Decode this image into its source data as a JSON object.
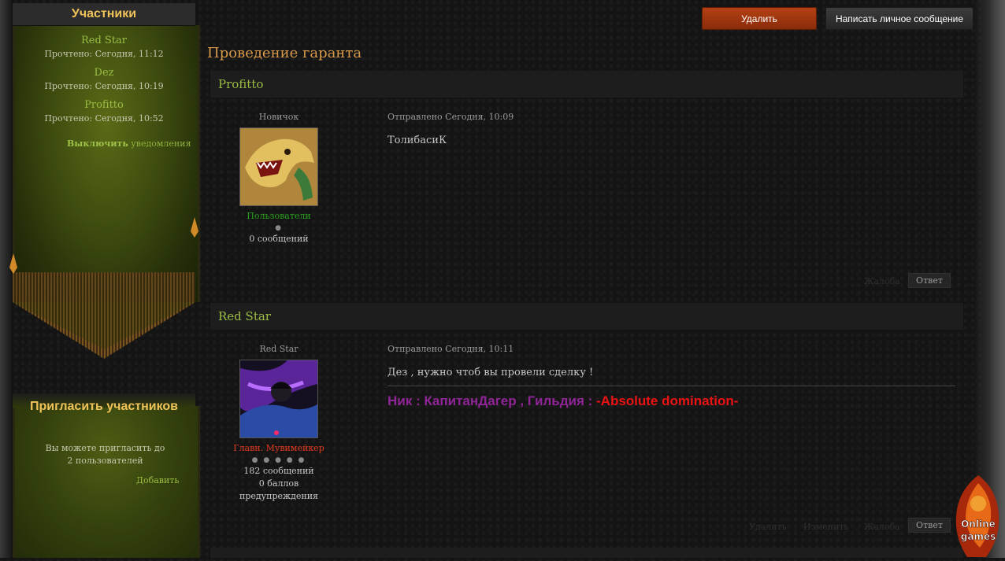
{
  "sidebar": {
    "members_title": "Участники",
    "members": [
      {
        "name": "Red Star",
        "read": "Прочтено: Сегодня, 11:12"
      },
      {
        "name": "Dez",
        "read": "Прочтено: Сегодня, 10:19"
      },
      {
        "name": "Profitto",
        "read": "Прочтено: Сегодня, 10:52"
      }
    ],
    "notify_strong": "Выключить",
    "notify_rest": "уведомления",
    "invite_title": "Пригласить участников",
    "invite_text": "Вы можете пригласить до 2 пользователей",
    "invite_add": "Добавить"
  },
  "toolbar": {
    "delete_label": "Удалить",
    "pm_label": "Написать личное сообщение"
  },
  "topic": {
    "title": "Проведение гаранта"
  },
  "posts": [
    {
      "author": "Profitto",
      "rank": "Новичок",
      "group": "Пользователи",
      "group_color": "#2aa11e",
      "pips": "●",
      "posts_count": "0 сообщений",
      "warnings": "",
      "date": "Отправлено Сегодня, 10:09",
      "body": "ТолибасиК",
      "actions": {
        "report": "Жалоба",
        "reply": "Ответ"
      }
    },
    {
      "author": "Red Star",
      "rank": "Red Star",
      "group": "Главн. Мувимейкер",
      "group_color": "#e03a1c",
      "pips": "● ● ● ● ●",
      "posts_count": "182 сообщений",
      "warnings": "0 баллов предупреждения",
      "date": "Отправлено Сегодня, 10:11",
      "body": "Дез , нужно чтоб вы провели сделку !",
      "signature_a": "Ник : КапитанДагер , Гильдия : ",
      "signature_b": "-Absolute domination-",
      "actions": {
        "delete": "Удалить",
        "edit": "Изменить",
        "report": "Жалоба",
        "reply": "Ответ"
      }
    }
  ],
  "logo": {
    "line1": "Online",
    "line2": "games"
  },
  "colors": {
    "accent": "#9bbd43",
    "title": "#d79a4a",
    "banner_title": "#f0c35a",
    "delete_btn": "#a33a10"
  }
}
